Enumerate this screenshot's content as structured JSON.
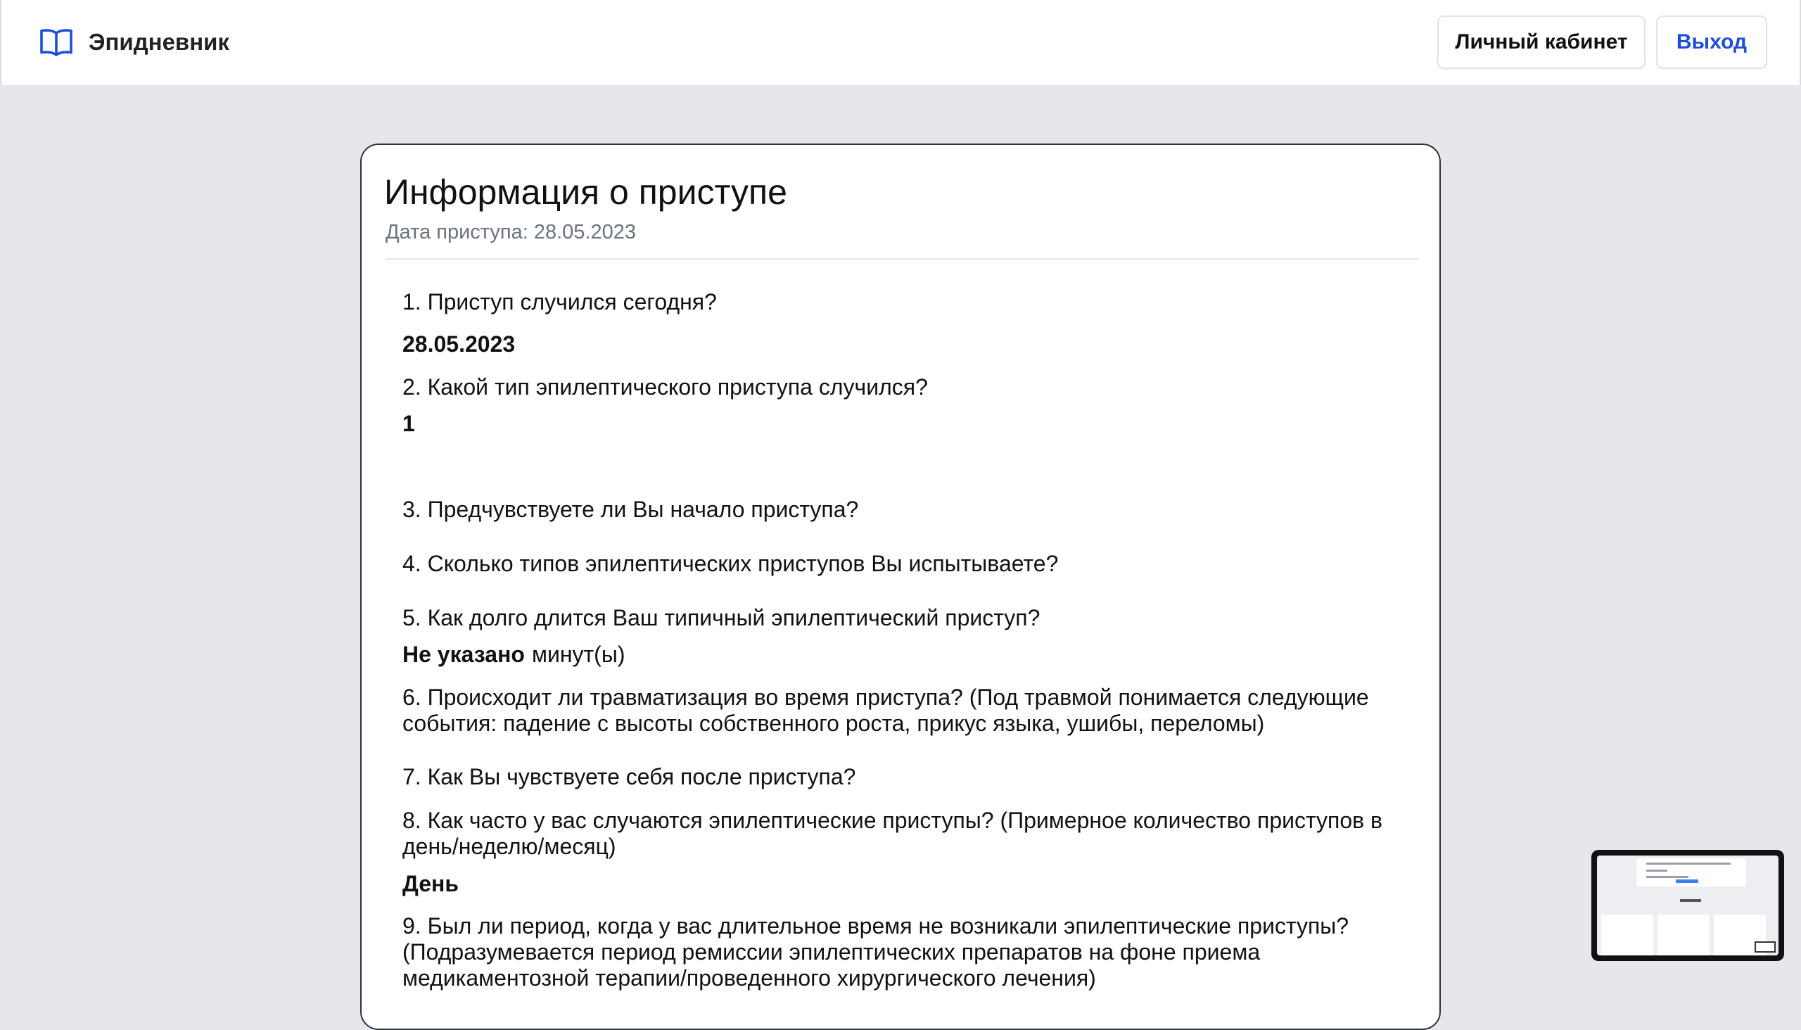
{
  "header": {
    "brand": "Эпидневник",
    "cabinet_label": "Личный кабинет",
    "exit_label": "Выход"
  },
  "card": {
    "title": "Информация о приступе",
    "date_line": "Дата приступа: 28.05.2023"
  },
  "questions": [
    {
      "q": "1. Приступ случился сегодня?",
      "a": "28.05.2023"
    },
    {
      "q": "2. Какой тип эпилептического приступа случился?",
      "a": "1"
    },
    {
      "q": "3. Предчувствуете ли Вы начало приступа?",
      "a": ""
    },
    {
      "q": "4. Сколько типов эпилептических приступов Вы испытываете?",
      "a": ""
    },
    {
      "q": "5. Как долго длится Ваш типичный эпилептический приступ?",
      "a": "Не указано",
      "unit": "минут(ы)"
    },
    {
      "q": "6. Происходит ли травматизация во время приступа? (Под травмой понимается следующие события: падение с высоты собственного роста, прикус языка, ушибы, переломы)",
      "a": ""
    },
    {
      "q": "7. Как Вы чувствуете себя после приступа?",
      "a": ""
    },
    {
      "q": "8. Как часто у вас случаются эпилептические приступы? (Примерное количество приступов в день/неделю/месяц)",
      "a": "День"
    },
    {
      "q": "9. Был ли период, когда у вас длительное время не возникали эпилептические приступы? (Подразумевается период ремиссии эпилептических препаратов на фоне приема медикаментозной терапии/проведенного хирургического лечения)",
      "a": ""
    }
  ],
  "icons": {
    "brand": "open-book-icon"
  },
  "colors": {
    "brand_icon": "#1d4ed8",
    "exit_text": "#1d4ed8",
    "page_bg": "#e5e7eb",
    "card_border": "#2b3240",
    "muted_text": "#6b7280"
  }
}
